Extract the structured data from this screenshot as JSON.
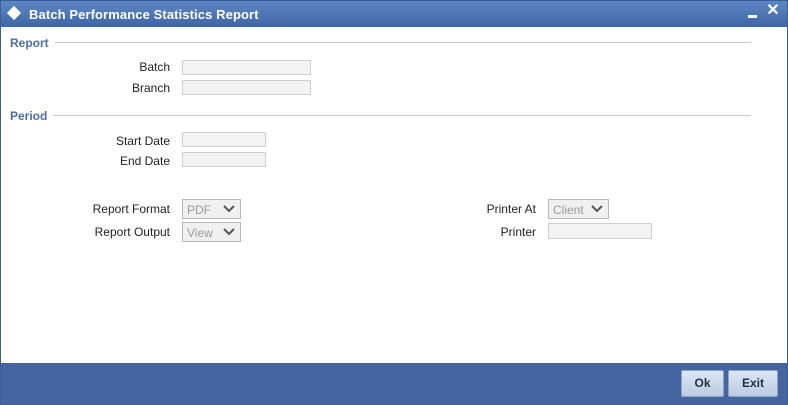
{
  "window": {
    "title": "Batch Performance Statistics Report",
    "close_glyph": "✕"
  },
  "report_section": {
    "title": "Report",
    "batch_label": "Batch",
    "batch_value": "",
    "branch_label": "Branch",
    "branch_value": ""
  },
  "period_section": {
    "title": "Period",
    "start_date_label": "Start Date",
    "start_date_value": "",
    "end_date_label": "End Date",
    "end_date_value": ""
  },
  "options": {
    "report_format_label": "Report Format",
    "report_format_value": "PDF",
    "report_output_label": "Report Output",
    "report_output_value": "View",
    "printer_at_label": "Printer At",
    "printer_at_value": "Client",
    "printer_label": "Printer",
    "printer_value": ""
  },
  "footer": {
    "ok_label": "Ok",
    "exit_label": "Exit"
  },
  "colors": {
    "titlebar": "#4a73b2",
    "footer": "#4565a0",
    "section_title": "#4a6fa5"
  },
  "icons": [
    "diamond-icon",
    "minimize-icon",
    "close-icon",
    "chevron-down-icon"
  ]
}
